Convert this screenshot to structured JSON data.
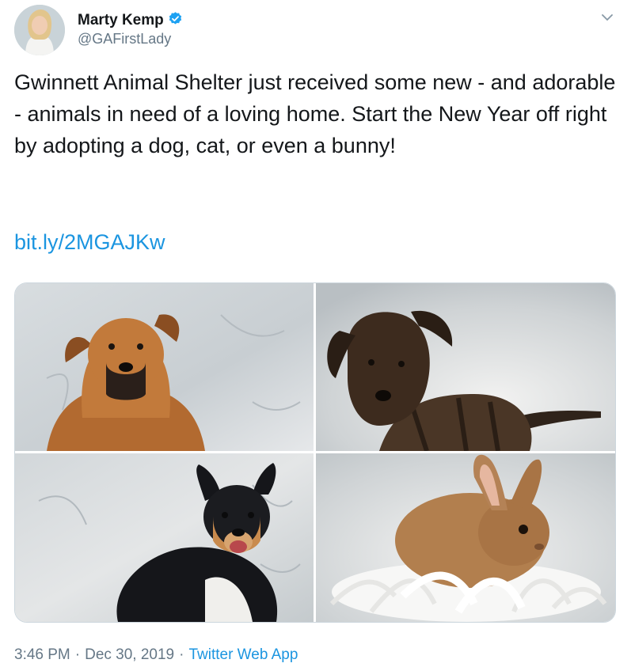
{
  "user": {
    "display_name": "Marty Kemp",
    "handle": "@GAFirstLady",
    "verified": true
  },
  "tweet": {
    "text": "Gwinnett Animal Shelter just received some new - and adorable - animals in need of a loving home. Start the New Year off right by adopting a dog, cat, or even a bunny!",
    "link": "bit.ly/2MGAJKw"
  },
  "media": [
    {
      "subject": "brown dog"
    },
    {
      "subject": "brindle puppy"
    },
    {
      "subject": "black and tan dog"
    },
    {
      "subject": "brown rabbit on white feathers"
    }
  ],
  "meta": {
    "time": "3:46 PM",
    "separator": "·",
    "date": "Dec 30, 2019",
    "source": "Twitter Web App"
  },
  "colors": {
    "link": "#1b95e0",
    "secondary_text": "#657786",
    "verified_badge": "#1da1f2"
  },
  "icons": [
    "verified-badge-icon",
    "chevron-down-icon"
  ]
}
